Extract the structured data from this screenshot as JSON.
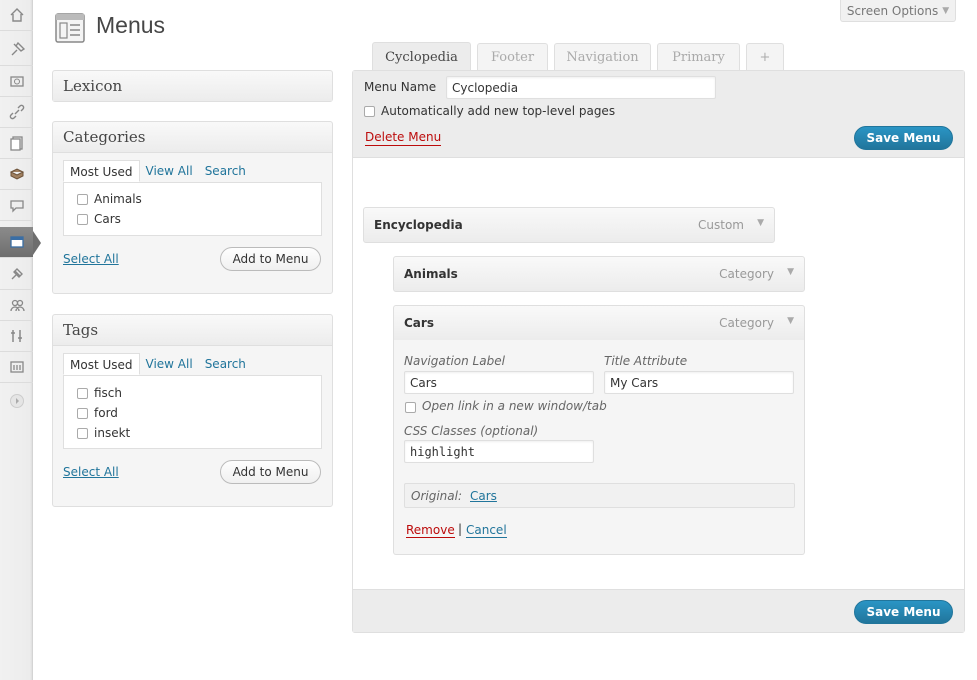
{
  "screen_options": {
    "label": "Screen Options",
    "arrow": "▼"
  },
  "page": {
    "title": "Menus"
  },
  "sidebar_icons": [
    "dashboard-icon",
    "posts-icon",
    "media-icon",
    "links-icon",
    "pages-icon",
    "library-icon",
    "comments-icon",
    "appearance-icon",
    "plugins-icon",
    "users-icon",
    "tools-icon",
    "settings-icon",
    "collapse-icon"
  ],
  "lexicon_box": {
    "title": "Lexicon"
  },
  "categories_box": {
    "title": "Categories",
    "tabs": [
      "Most Used",
      "View All",
      "Search"
    ],
    "items": [
      "Animals",
      "Cars"
    ],
    "select_all": "Select All",
    "add_button": "Add to Menu"
  },
  "tags_box": {
    "title": "Tags",
    "tabs": [
      "Most Used",
      "View All",
      "Search"
    ],
    "items": [
      "fisch",
      "ford",
      "insekt"
    ],
    "select_all": "Select All",
    "add_button": "Add to Menu"
  },
  "menu_tabs": [
    "Cyclopedia",
    "Footer",
    "Navigation",
    "Primary",
    "+"
  ],
  "menu_header": {
    "name_label": "Menu Name",
    "name_value": "Cyclopedia",
    "auto_add_label": "Automatically add new top-level pages",
    "delete_label": "Delete Menu",
    "save_label": "Save Menu"
  },
  "menu_items": [
    {
      "title": "Encyclopedia",
      "type": "Custom",
      "arrow": "▼"
    },
    {
      "title": "Animals",
      "type": "Category",
      "arrow": "▼"
    },
    {
      "title": "Cars",
      "type": "Category",
      "arrow": "▼"
    }
  ],
  "item_settings": {
    "nav_label_label": "Navigation Label",
    "nav_label_value": "Cars",
    "title_attr_label": "Title Attribute",
    "title_attr_value": "My Cars",
    "new_window_label": "Open link in a new window/tab",
    "css_label": "CSS Classes (optional)",
    "css_value": "highlight",
    "original_label": "Original:",
    "original_link": "Cars",
    "remove_label": "Remove",
    "separator": "|",
    "cancel_label": "Cancel"
  },
  "footer": {
    "save_label": "Save Menu"
  },
  "colors": {
    "link": "#21759b",
    "delete": "#bc0b0b",
    "primary": "#21759b"
  }
}
